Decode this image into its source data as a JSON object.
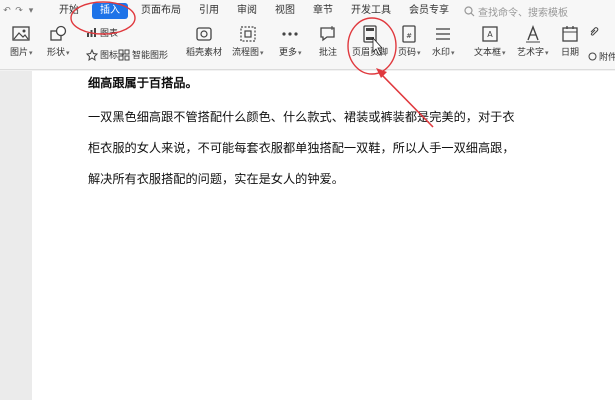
{
  "menubar": {
    "tabs": [
      "开始",
      "插入",
      "页面布局",
      "引用",
      "审阅",
      "视图",
      "章节",
      "开发工具",
      "会员专享"
    ],
    "active_tab": "插入",
    "search_placeholder": "查找命令、搜索模板"
  },
  "ribbon": {
    "picture": "图片",
    "shape": "形状",
    "chart": "图表",
    "icons": "图标",
    "smart_art": "智能图形",
    "material": "稻壳素材",
    "flowchart": "流程图",
    "more": "更多",
    "comment": "批注",
    "header_footer": "页眉页脚",
    "page_number": "页码",
    "watermark": "水印",
    "textbox": "文本框",
    "wordart": "艺术字",
    "date": "日期",
    "attachment": "附件"
  },
  "document": {
    "heading": "细高跟属于百搭品。",
    "lines": [
      "一双黑色细高跟不管搭配什么颜色、什么款式、裙装或裤装都是完美的，对于衣",
      "柜衣服的女人来说，不可能每套衣服都单独搭配一双鞋，所以人手一双细高跟，",
      "解决所有衣服搭配的问题，实在是女人的钟爱。"
    ]
  },
  "colors": {
    "accent": "#1e73e8",
    "annotation": "#e0393e"
  }
}
